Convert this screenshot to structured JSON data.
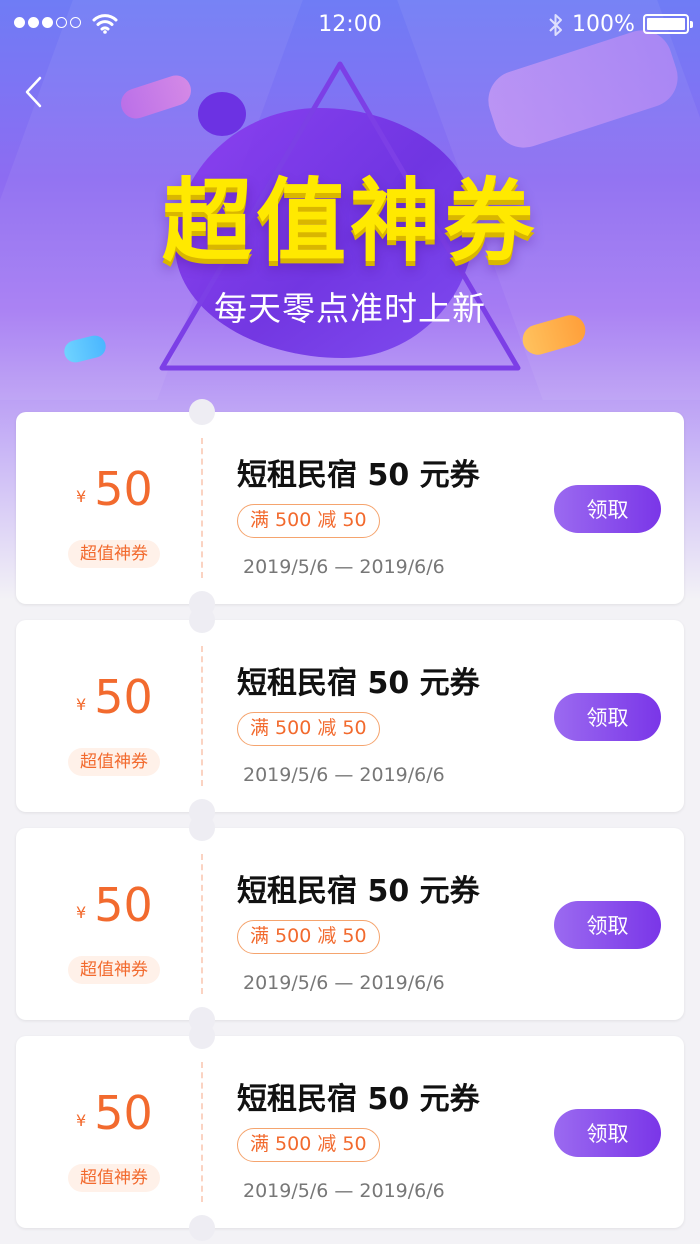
{
  "status_bar": {
    "time": "12:00",
    "battery": "100%",
    "signal_bars_filled": 3,
    "signal_bars_total": 5
  },
  "hero": {
    "title": "超值神券",
    "subtitle": "每天零点准时上新"
  },
  "colors": {
    "accent_purple": "#7a36e8",
    "accent_orange": "#f26a2e",
    "title_yellow": "#ffe900"
  },
  "coupons": [
    {
      "currency": "¥",
      "amount": "50",
      "tag": "超值神券",
      "name": "短租民宿 50 元券",
      "rule": "满 500 减 50",
      "dates": "2019/5/6 — 2019/6/6",
      "button": "领取"
    },
    {
      "currency": "¥",
      "amount": "50",
      "tag": "超值神券",
      "name": "短租民宿 50 元券",
      "rule": "满 500 减 50",
      "dates": "2019/5/6 — 2019/6/6",
      "button": "领取"
    },
    {
      "currency": "¥",
      "amount": "50",
      "tag": "超值神券",
      "name": "短租民宿 50 元券",
      "rule": "满 500 减 50",
      "dates": "2019/5/6 — 2019/6/6",
      "button": "领取"
    },
    {
      "currency": "¥",
      "amount": "50",
      "tag": "超值神券",
      "name": "短租民宿 50 元券",
      "rule": "满 500 减 50",
      "dates": "2019/5/6 — 2019/6/6",
      "button": "领取"
    }
  ]
}
